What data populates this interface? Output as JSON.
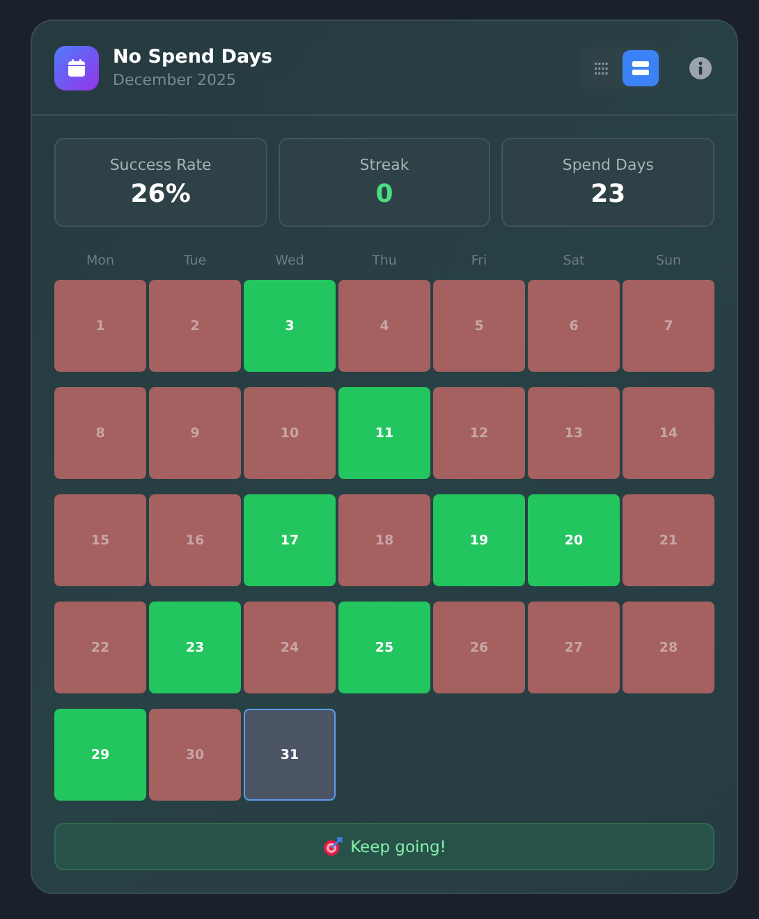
{
  "header": {
    "title": "No Spend Days",
    "subtitle": "December 2025"
  },
  "view_toggle": [
    {
      "kind": "grid",
      "selected": false
    },
    {
      "kind": "list",
      "selected": true
    }
  ],
  "stats": [
    {
      "label": "Success Rate",
      "value": "26%",
      "kind": "plain"
    },
    {
      "label": "Streak",
      "value": "0",
      "kind": "good"
    },
    {
      "label": "Spend Days",
      "value": "23",
      "kind": "plain"
    }
  ],
  "weekdays": [
    "Mon",
    "Tue",
    "Wed",
    "Thu",
    "Fri",
    "Sat",
    "Sun"
  ],
  "days": [
    {
      "label": "1",
      "kind": "spend"
    },
    {
      "label": "2",
      "kind": "spend"
    },
    {
      "label": "3",
      "kind": "nospend"
    },
    {
      "label": "4",
      "kind": "spend"
    },
    {
      "label": "5",
      "kind": "spend"
    },
    {
      "label": "6",
      "kind": "spend"
    },
    {
      "label": "7",
      "kind": "spend"
    },
    {
      "label": "8",
      "kind": "spend"
    },
    {
      "label": "9",
      "kind": "spend"
    },
    {
      "label": "10",
      "kind": "spend"
    },
    {
      "label": "11",
      "kind": "nospend"
    },
    {
      "label": "12",
      "kind": "spend"
    },
    {
      "label": "13",
      "kind": "spend"
    },
    {
      "label": "14",
      "kind": "spend"
    },
    {
      "label": "15",
      "kind": "spend"
    },
    {
      "label": "16",
      "kind": "spend"
    },
    {
      "label": "17",
      "kind": "nospend"
    },
    {
      "label": "18",
      "kind": "spend"
    },
    {
      "label": "19",
      "kind": "nospend"
    },
    {
      "label": "20",
      "kind": "nospend"
    },
    {
      "label": "21",
      "kind": "spend"
    },
    {
      "label": "22",
      "kind": "spend"
    },
    {
      "label": "23",
      "kind": "nospend"
    },
    {
      "label": "24",
      "kind": "spend"
    },
    {
      "label": "25",
      "kind": "nospend"
    },
    {
      "label": "26",
      "kind": "spend"
    },
    {
      "label": "27",
      "kind": "spend"
    },
    {
      "label": "28",
      "kind": "spend"
    },
    {
      "label": "29",
      "kind": "nospend"
    },
    {
      "label": "30",
      "kind": "spend"
    },
    {
      "label": "31",
      "kind": "today"
    }
  ],
  "footer": {
    "message": "Keep going!"
  }
}
